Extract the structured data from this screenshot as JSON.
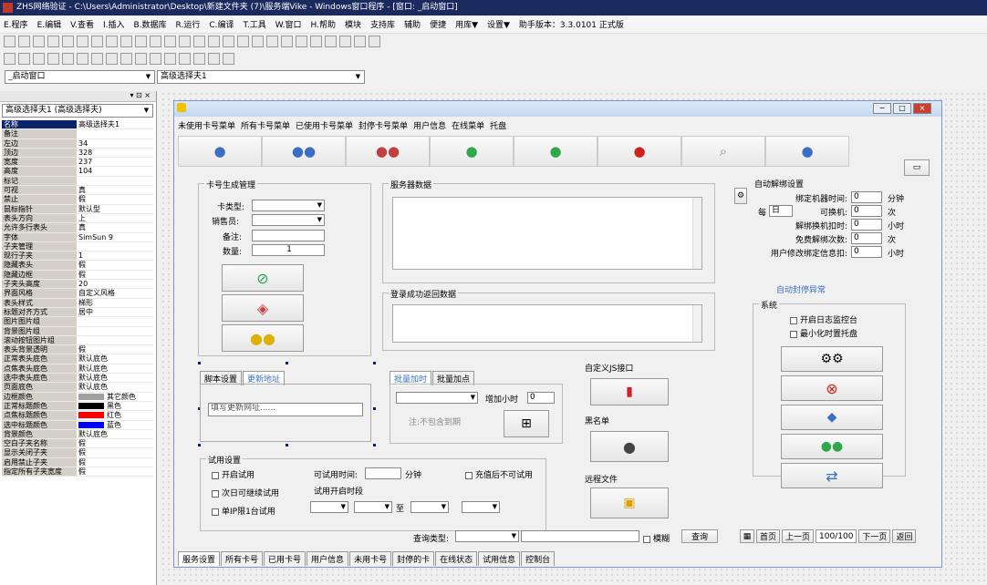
{
  "window": {
    "title": "ZHS网络验证 - C:\\Users\\Administrator\\Desktop\\新建文件夹 (7)\\服务端Vike - Windows窗口程序 - [窗口: _启动窗口]"
  },
  "menu": [
    "E.程序",
    "E.编辑",
    "V.查看",
    "I.插入",
    "B.数据库",
    "R.运行",
    "C.编译",
    "T.工具",
    "W.窗口",
    "H.帮助",
    "模块",
    "支持库",
    "辅助",
    "便捷",
    "用库▼",
    "设置▼",
    "助手版本：3.3.0101 正式版"
  ],
  "toolbar_row3": {
    "window_combo": "_启动窗口",
    "close_x": "×",
    "control_combo": "高级选择夫1"
  },
  "left_panel": {
    "title_combo": "高级选择夫1 (高级选择夫)",
    "properties": [
      {
        "k": "名称",
        "v": "高级选择夫1"
      },
      {
        "k": "备注",
        "v": ""
      },
      {
        "k": "左边",
        "v": "34"
      },
      {
        "k": "顶边",
        "v": "328"
      },
      {
        "k": "宽度",
        "v": "237"
      },
      {
        "k": "高度",
        "v": "104"
      },
      {
        "k": "标记",
        "v": ""
      },
      {
        "k": "可视",
        "v": "真"
      },
      {
        "k": "禁止",
        "v": "假"
      },
      {
        "k": "鼠标指针",
        "v": "默认型"
      },
      {
        "k": "表头方向",
        "v": "上"
      },
      {
        "k": "允许多行表头",
        "v": "真"
      },
      {
        "k": "字体",
        "v": "SimSun 9"
      },
      {
        "k": "子夹管理",
        "v": ""
      },
      {
        "k": "现行子夹",
        "v": "1"
      },
      {
        "k": "隐藏表头",
        "v": "假"
      },
      {
        "k": "隐藏边框",
        "v": "假"
      },
      {
        "k": "子夹头高度",
        "v": "20"
      },
      {
        "k": "界面风格",
        "v": "自定义风格"
      },
      {
        "k": "表头样式",
        "v": "梯形"
      },
      {
        "k": "标题对齐方式",
        "v": "居中"
      },
      {
        "k": "图片图片组",
        "v": ""
      },
      {
        "k": "背景图片组",
        "v": ""
      },
      {
        "k": "滚动按钮图片组",
        "v": ""
      },
      {
        "k": "表头背景透明",
        "v": "假"
      },
      {
        "k": "正常表头底色",
        "v": "默认底色"
      },
      {
        "k": "点焦表头底色",
        "v": "默认底色"
      },
      {
        "k": "选中表头底色",
        "v": "默认底色"
      },
      {
        "k": "页面底色",
        "v": "默认底色"
      },
      {
        "k": "边框颜色",
        "v": "其它颜色",
        "swatch": "#a0a0a0"
      },
      {
        "k": "正常标题颜色",
        "v": "黑色",
        "swatch": "#000000"
      },
      {
        "k": "点焦标题颜色",
        "v": "红色",
        "swatch": "#ff0000"
      },
      {
        "k": "选中标题颜色",
        "v": "蓝色",
        "swatch": "#0000ff"
      },
      {
        "k": "背景颜色",
        "v": "默认底色"
      },
      {
        "k": "空白子夹名称",
        "v": "假"
      },
      {
        "k": "显示关闭子夹",
        "v": "假"
      },
      {
        "k": "启用禁止子夹",
        "v": "假"
      },
      {
        "k": "指定所有子夹宽度",
        "v": "假"
      }
    ]
  },
  "form": {
    "menu": [
      "未使用卡号菜单",
      "所有卡号菜单",
      "已使用卡号菜单",
      "封停卡号菜单",
      "用户信息",
      "在线菜单",
      "托盘"
    ],
    "card_gen": {
      "title": "卡号生成管理",
      "type_label": "卡类型:",
      "seller_label": "销售员:",
      "note_label": "备注:",
      "count_label": "数量:",
      "count_value": "1"
    },
    "server_data": {
      "title": "服务器数据"
    },
    "login_return": {
      "title": "登录成功返回数据"
    },
    "unbind": {
      "title": "自动解绑设置",
      "rows": [
        {
          "label": "绑定机器时间:",
          "value": "0",
          "unit": "分钟"
        },
        {
          "label": "可换机:",
          "value": "0",
          "unit": "次"
        },
        {
          "label": "解绑换机扣时:",
          "value": "0",
          "unit": "小时"
        },
        {
          "label": "免费解绑次数:",
          "value": "0",
          "unit": "次"
        },
        {
          "label": "用户修改绑定信息扣:",
          "value": "0",
          "unit": "小时"
        }
      ],
      "per_prefix": "每",
      "per_value": "日",
      "auto_seal_link": "自动封停异常"
    },
    "system": {
      "title": "系统",
      "chk1": "开启日志监控台",
      "chk2": "最小化时置托盘"
    },
    "tabs_left": [
      "脚本设置",
      "更新地址"
    ],
    "update_url_value": "填写更新网址......",
    "tabs_mid": [
      "批量加时",
      "批量加点"
    ],
    "add_hours_label": "增加小时",
    "add_hours_value": "0",
    "note_not_expired": "注:不包含到期",
    "custom_js": "自定义JS接口",
    "blacklist": "黑名单",
    "remote_file": "远程文件",
    "trial": {
      "title": "试用设置",
      "chk_enable": "开启试用",
      "time_label": "可试用时间:",
      "time_unit": "分钟",
      "chk_after_pay": "充值后不可试用",
      "chk_next_day": "次日可继续试用",
      "chk_single": "单IP限1台试用",
      "start_label": "试用开启时段",
      "to": "至"
    },
    "query_label": "查询类型:",
    "fuzzy": "模糊",
    "query_btn": "查询",
    "pager": {
      "first": "首页",
      "prev": "上一页",
      "info": "100/100",
      "next": "下一页",
      "back": "返回"
    },
    "bottom_tabs": [
      "服务设置",
      "所有卡号",
      "已用卡号",
      "用户信息",
      "未用卡号",
      "封停的卡",
      "在线状态",
      "试用信息",
      "控制台"
    ]
  },
  "colors": {
    "titlebar": "#1a2a5e",
    "selected": "#0a246a",
    "accent_blue": "#3a6fc4"
  }
}
